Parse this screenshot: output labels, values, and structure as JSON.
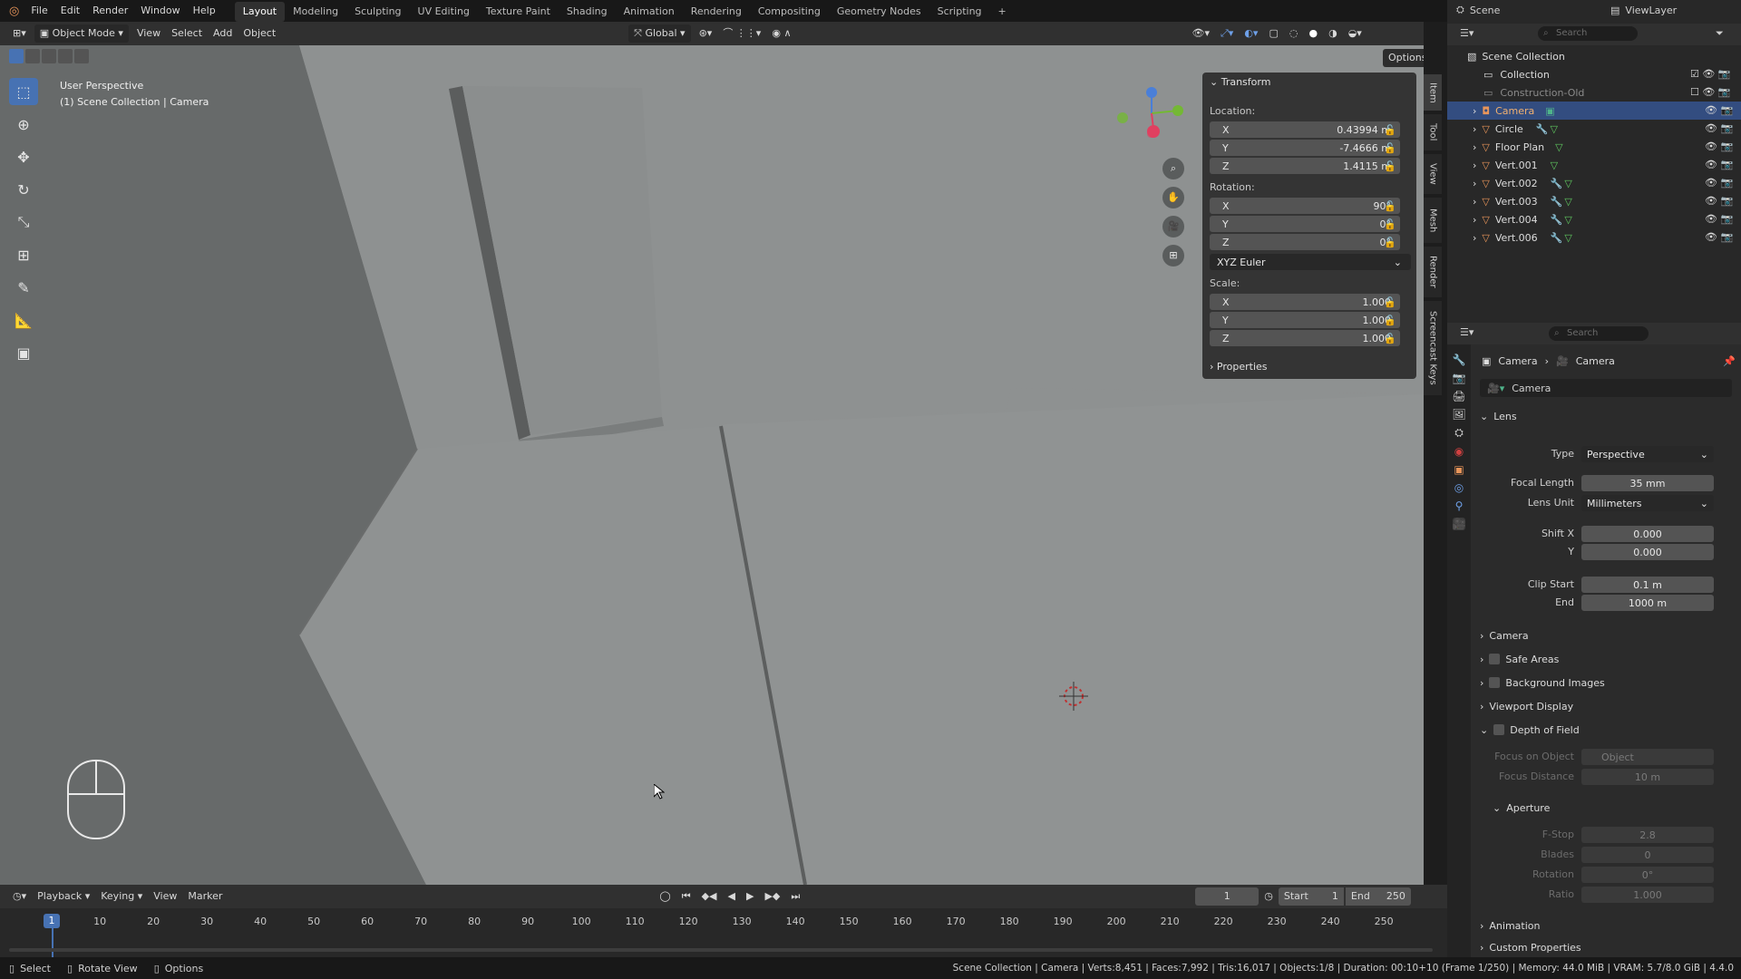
{
  "menu": {
    "items": [
      "File",
      "Edit",
      "Render",
      "Window",
      "Help"
    ]
  },
  "workspaces": [
    "Layout",
    "Modeling",
    "Sculpting",
    "UV Editing",
    "Texture Paint",
    "Shading",
    "Animation",
    "Rendering",
    "Compositing",
    "Geometry Nodes",
    "Scripting"
  ],
  "scene": {
    "name": "Scene",
    "view_layer": "ViewLayer"
  },
  "viewport_header": {
    "mode": "Object Mode",
    "menus": [
      "View",
      "Select",
      "Add",
      "Object"
    ],
    "transform_orientation": "Global",
    "options": "Options"
  },
  "viewport": {
    "perspective": "User Perspective",
    "collection_info": "(1) Scene Collection | Camera"
  },
  "npanel": {
    "transform_title": "Transform",
    "location_label": "Location:",
    "location": {
      "x": "0.43994 m",
      "y": "-7.4666 m",
      "z": "1.4115 m"
    },
    "rotation_label": "Rotation:",
    "rotation": {
      "x": "90°",
      "y": "0°",
      "z": "0°"
    },
    "rotation_mode": "XYZ Euler",
    "scale_label": "Scale:",
    "scale": {
      "x": "1.000",
      "y": "1.000",
      "z": "1.000"
    },
    "properties_title": "Properties",
    "axis": {
      "x": "X",
      "y": "Y",
      "z": "Z"
    }
  },
  "side_tabs": [
    "Item",
    "Tool",
    "View",
    "Mesh",
    "Render",
    "Screencast Keys"
  ],
  "outliner": {
    "search_placeholder": "Search",
    "root": "Scene Collection",
    "items": [
      "Collection",
      "Construction-Old",
      "Camera",
      "Circle",
      "Floor Plan",
      "Vert.001",
      "Vert.002",
      "Vert.003",
      "Vert.004",
      "Vert.006"
    ]
  },
  "properties": {
    "search_placeholder": "Search",
    "breadcrumb": [
      "Camera",
      "Camera"
    ],
    "datablock": "Camera",
    "lens": {
      "title": "Lens",
      "type_label": "Type",
      "type": "Perspective",
      "focal_label": "Focal Length",
      "focal": "35 mm",
      "unit_label": "Lens Unit",
      "unit": "Millimeters",
      "shiftx_label": "Shift X",
      "shiftx": "0.000",
      "shifty_label": "Y",
      "shifty": "0.000",
      "clipstart_label": "Clip Start",
      "clipstart": "0.1 m",
      "clipend_label": "End",
      "clipend": "1000 m"
    },
    "sections": {
      "camera": "Camera",
      "safe": "Safe Areas",
      "bg": "Background Images",
      "vdisp": "Viewport Display",
      "dof": "Depth of Field"
    },
    "dof": {
      "focus_obj_label": "Focus on Object",
      "focus_obj": "Object",
      "focus_dist_label": "Focus Distance",
      "focus_dist": "10 m",
      "aperture": "Aperture",
      "fstop_label": "F-Stop",
      "fstop": "2.8",
      "blades_label": "Blades",
      "blades": "0",
      "rotation_label": "Rotation",
      "rotation": "0°",
      "ratio_label": "Ratio",
      "ratio": "1.000"
    },
    "animation": "Animation",
    "custom": "Custom Properties",
    "tabs": [
      "tool-tab",
      "render-tab",
      "output-tab",
      "view-layer-tab",
      "scene-tab",
      "world-tab",
      "object-tab",
      "physics-tab",
      "constraints-tab",
      "camera-data-tab"
    ]
  },
  "timeline": {
    "menus": [
      "Playback",
      "Keying",
      "View",
      "Marker"
    ],
    "current_frame": "1",
    "start_label": "Start",
    "start": "1",
    "end_label": "End",
    "end": "250",
    "ticks": [
      "1",
      "10",
      "20",
      "30",
      "40",
      "50",
      "60",
      "70",
      "80",
      "90",
      "100",
      "110",
      "120",
      "130",
      "140",
      "150",
      "160",
      "170",
      "180",
      "190",
      "200",
      "210",
      "220",
      "230",
      "240",
      "250"
    ]
  },
  "status": {
    "select": "Select",
    "rotate": "Rotate View",
    "options": "Options",
    "info": "Scene Collection | Camera | Verts:8,451 | Faces:7,992 | Tris:16,017 | Objects:1/8 | Duration: 00:10+10 (Frame 1/250) | Memory: 44.0 MiB | VRAM: 5.7/8.0 GiB | 4.4.0"
  },
  "colors": {
    "accent": "#4772b3",
    "selected_row": "#334d80",
    "object_orange": "#e8955a",
    "mesh_green": "#5fc75f",
    "camera_green": "#4fb38a"
  }
}
